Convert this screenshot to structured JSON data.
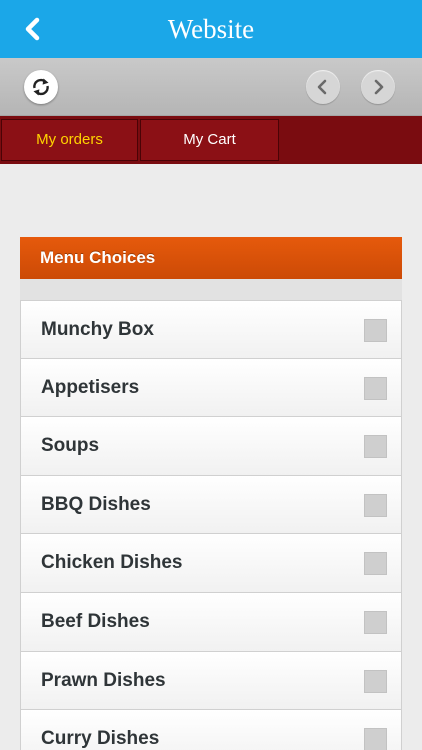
{
  "header": {
    "title": "Website",
    "back_icon": "chevron-left-icon"
  },
  "toolbar": {
    "refresh_icon": "refresh-icon",
    "prev_icon": "chevron-left-icon",
    "next_icon": "chevron-right-icon"
  },
  "tabs": [
    {
      "label": "My orders",
      "active": true
    },
    {
      "label": "My Cart",
      "active": false
    }
  ],
  "panel": {
    "title": "Menu Choices",
    "items": [
      {
        "label": "Munchy Box",
        "checked": false
      },
      {
        "label": "Appetisers",
        "checked": false
      },
      {
        "label": "Soups",
        "checked": false
      },
      {
        "label": "BBQ Dishes",
        "checked": false
      },
      {
        "label": "Chicken Dishes",
        "checked": false
      },
      {
        "label": "Beef Dishes",
        "checked": false
      },
      {
        "label": "Prawn Dishes",
        "checked": false
      },
      {
        "label": "Curry Dishes",
        "checked": false
      }
    ]
  },
  "colors": {
    "titlebar": "#1ba7e8",
    "tabbar": "#7a0c10",
    "active_tab_text": "#ffd400",
    "panel_header": "#e05208"
  }
}
